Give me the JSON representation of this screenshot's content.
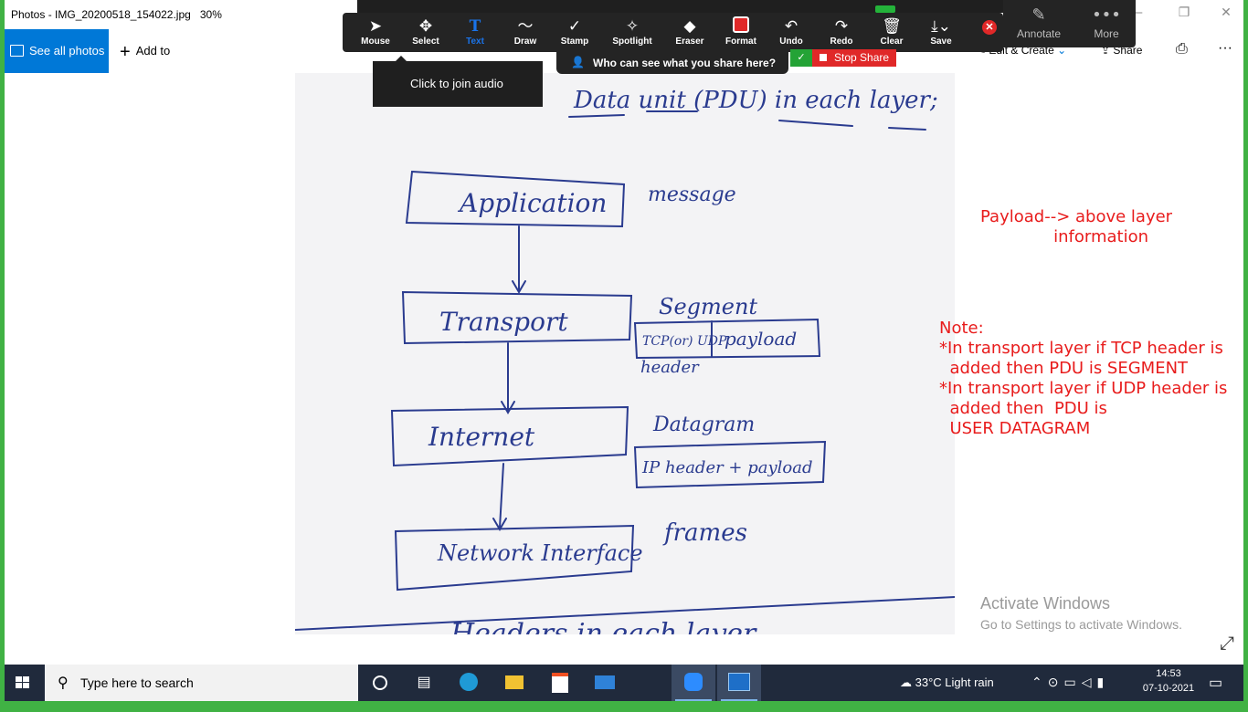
{
  "window": {
    "title": "Photos - IMG_20200518_154022.jpg",
    "zoom": "30%",
    "controls": [
      "—",
      "❐",
      "✕"
    ]
  },
  "photos_toolbar": {
    "see_all": "See all photos",
    "add_to": "Add to",
    "edit_create": "Edit & Create",
    "share": "Share",
    "more": "···"
  },
  "zoom_annotate": {
    "tools": [
      {
        "label": "Mouse",
        "icon": "mouse-pointer-icon"
      },
      {
        "label": "Select",
        "icon": "move-icon"
      },
      {
        "label": "Text",
        "icon": "text-icon"
      },
      {
        "label": "Draw",
        "icon": "draw-icon"
      },
      {
        "label": "Stamp",
        "icon": "stamp-icon"
      },
      {
        "label": "Spotlight",
        "icon": "spotlight-icon"
      },
      {
        "label": "Eraser",
        "icon": "eraser-icon"
      },
      {
        "label": "Format",
        "icon": "format-icon"
      },
      {
        "label": "Undo",
        "icon": "undo-icon"
      },
      {
        "label": "Redo",
        "icon": "redo-icon"
      },
      {
        "label": "Clear",
        "icon": "trash-icon"
      },
      {
        "label": "Save",
        "icon": "save-icon"
      }
    ],
    "annotate_label": "Annotate",
    "more_label": "More",
    "who_share": "Who can see what you share here?",
    "stop_share": "Stop Share",
    "tooltip": "Click to join audio",
    "accent_red": "#e02828",
    "text_color": "#1a73e8"
  },
  "handwriting": {
    "heading": "Data unit (PDU) in each layer;",
    "layers": [
      "Application",
      "Transport",
      "Internet",
      "Network Interface"
    ],
    "pdus": [
      "message",
      "Segment",
      "Datagram",
      "frames"
    ],
    "segment_box_left": "TCP(or) UDP",
    "segment_box_right": "payload",
    "segment_box_below": "header",
    "datagram_box": "IP header + payload",
    "footer": "Headers in each layer"
  },
  "annotations": {
    "payload": "Payload--> above layer\n              information",
    "note_title": "Note:",
    "note_tcp": "*In transport layer if TCP header is\n  added then PDU is SEGMENT",
    "note_udp": "*In transport layer if UDP header is\n  added then  PDU is\n  USER DATAGRAM",
    "color": "#e81c1c"
  },
  "watermark": {
    "line1": "Activate Windows",
    "line2": "Go to Settings to activate Windows."
  },
  "taskbar": {
    "search_placeholder": "Type here to search",
    "weather": "33°C  Light rain",
    "time": "14:53",
    "date": "07-10-2021"
  }
}
